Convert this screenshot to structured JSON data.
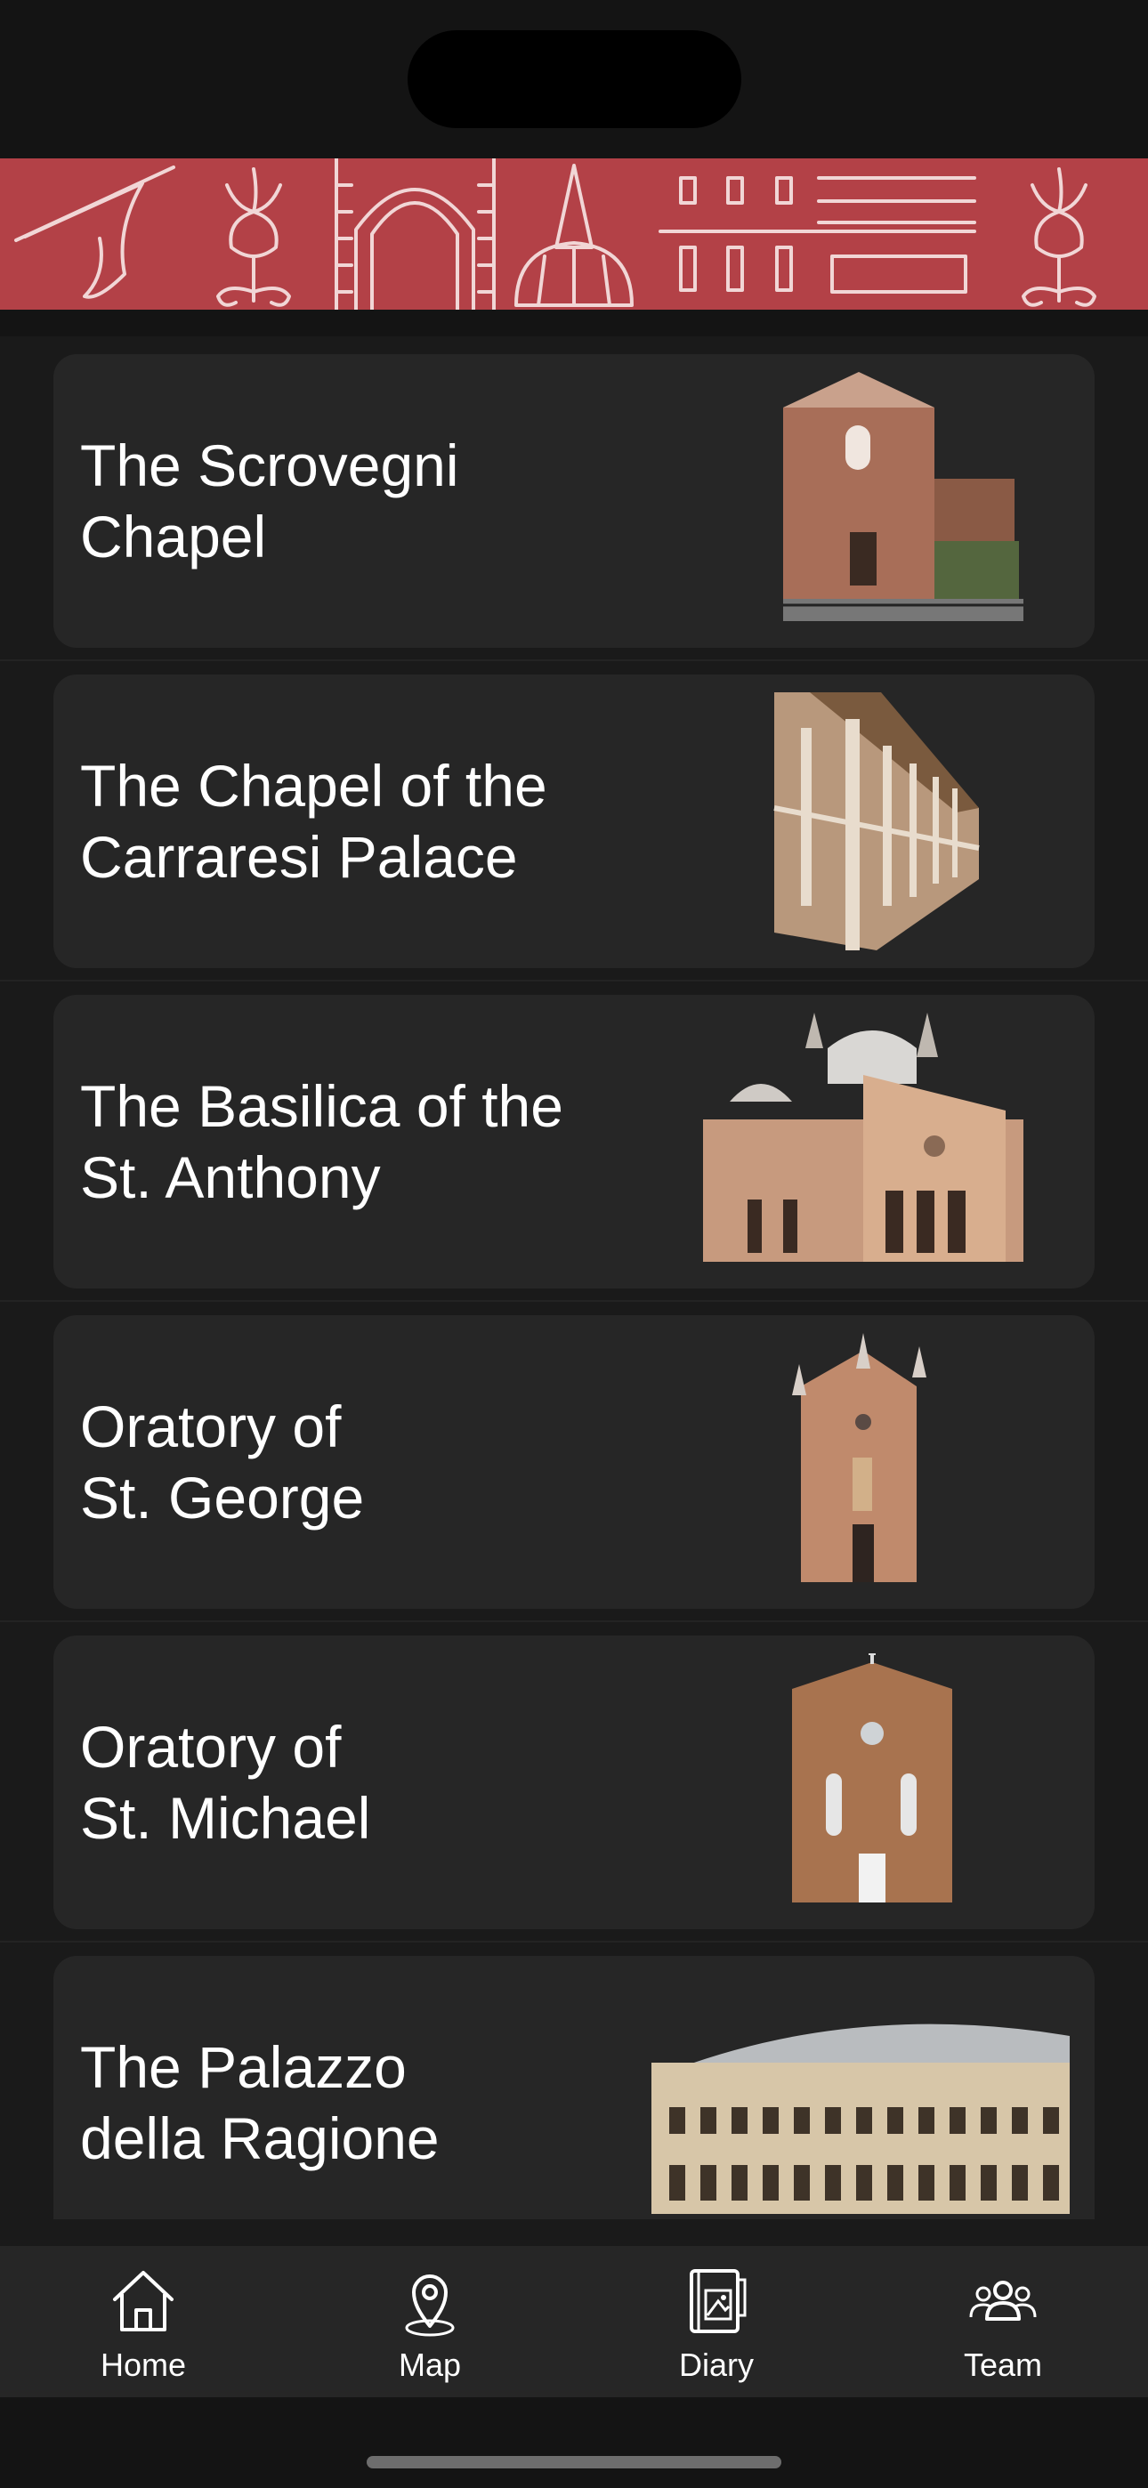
{
  "colors": {
    "banner": "#b34147",
    "card": "#262626",
    "background": "#1a1a1a",
    "text": "#ffffff"
  },
  "sites": [
    {
      "title": "The Scrovegni\nChapel",
      "icon": "scrovegni-chapel-icon"
    },
    {
      "title": "The Chapel of the\nCarraresi Palace",
      "icon": "carraresi-loggia-icon"
    },
    {
      "title": "The Basilica of the\nSt. Anthony",
      "icon": "basilica-icon"
    },
    {
      "title": "Oratory of\nSt. George",
      "icon": "oratory-st-george-icon"
    },
    {
      "title": "Oratory of\nSt. Michael",
      "icon": "oratory-st-michael-icon"
    },
    {
      "title": "The Palazzo\ndella Ragione",
      "icon": "palazzo-ragione-icon"
    }
  ],
  "tabbar": [
    {
      "label": "Home",
      "icon": "home-icon"
    },
    {
      "label": "Map",
      "icon": "map-pin-icon"
    },
    {
      "label": "Diary",
      "icon": "diary-icon"
    },
    {
      "label": "Team",
      "icon": "team-icon"
    }
  ]
}
